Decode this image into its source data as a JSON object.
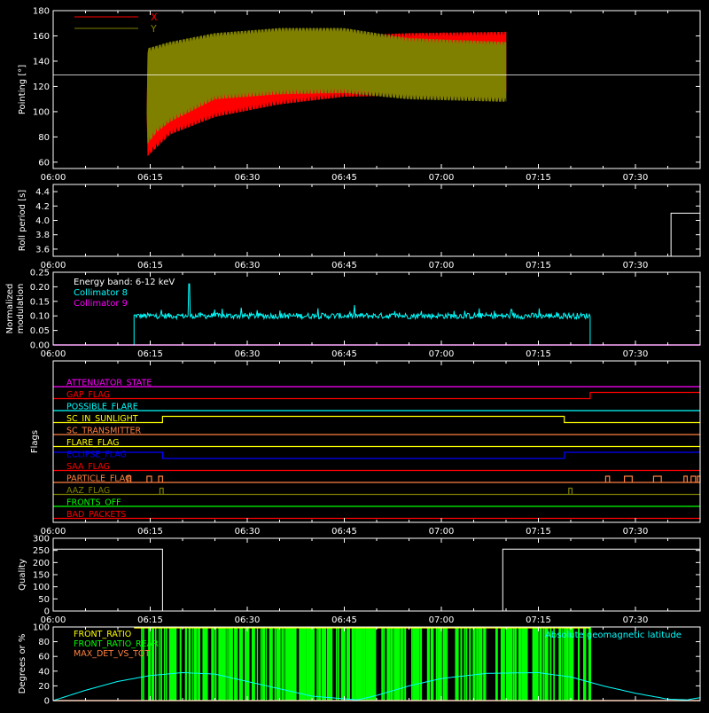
{
  "x_axis": {
    "ticks": [
      "06:00",
      "06:15",
      "06:30",
      "06:45",
      "07:00",
      "07:15",
      "07:30"
    ],
    "range_minutes": [
      0,
      100
    ]
  },
  "chart_data": [
    {
      "type": "area",
      "ylabel": "Pointing [°]",
      "ylim": [
        55,
        180
      ],
      "yticks": [
        "60",
        "80",
        "100",
        "120",
        "140",
        "160",
        "180"
      ],
      "reference_line_y": 129,
      "legend": [
        {
          "label": "X",
          "color": "#ff0000"
        },
        {
          "label": "Y",
          "color": "#808000"
        }
      ],
      "series": [
        {
          "name": "X",
          "color": "#ff0000",
          "x_minutes": [
            14.5,
            14.6,
            16,
            18,
            25,
            35,
            45,
            55,
            70
          ],
          "upper": [
            100,
            150,
            145,
            147,
            152,
            155,
            160,
            162,
            163
          ],
          "lower": [
            100,
            65,
            72,
            82,
            96,
            106,
            112,
            113,
            115
          ]
        },
        {
          "name": "Y",
          "color": "#808000",
          "x_minutes": [
            14.5,
            14.6,
            16,
            18,
            25,
            35,
            45,
            55,
            70
          ],
          "upper": [
            100,
            150,
            152,
            155,
            162,
            166,
            166,
            158,
            155
          ],
          "lower": [
            100,
            75,
            84,
            92,
            110,
            114,
            115,
            110,
            108
          ]
        }
      ]
    },
    {
      "type": "line",
      "ylabel": "Roll period [s]",
      "ylim": [
        3.5,
        4.5
      ],
      "yticks": [
        "3.6",
        "3.8",
        "4.0",
        "4.2",
        "4.4"
      ],
      "series": [
        {
          "name": "",
          "color": "#ffffff",
          "x_minutes": [
            95.5,
            95.5,
            100
          ],
          "values": [
            3.5,
            4.1,
            4.1
          ]
        }
      ]
    },
    {
      "type": "line",
      "ylabel": "Normalized modulation",
      "ylim": [
        0,
        0.25
      ],
      "yticks": [
        "0.00",
        "0.05",
        "0.10",
        "0.15",
        "0.20",
        "0.25"
      ],
      "legend_title": "Energy band: 6-12 keV",
      "legend": [
        {
          "label": "Collimator 8",
          "color": "#00ffff"
        },
        {
          "label": "Collimator 9",
          "color": "#ff00ff"
        }
      ],
      "series": [
        {
          "name": "Collimator 8",
          "color": "#00ffff",
          "x_range": [
            12.5,
            83
          ],
          "typical": 0.1,
          "spread": 0.01,
          "spike": [
            21,
            0.21
          ]
        },
        {
          "name": "Collimator 9",
          "color": "#ff00ff",
          "x_range": [
            0,
            100
          ],
          "typical": 0,
          "spread": 0
        }
      ]
    },
    {
      "type": "line",
      "ylabel": "Flags",
      "flags": [
        {
          "label": "ATTENUATOR_STATE",
          "color": "#ff00ff",
          "segments": [
            [
              0,
              100,
              0
            ]
          ]
        },
        {
          "label": "GAP_FLAG",
          "color": "#ff0000",
          "segments": [
            [
              0,
              83,
              0
            ],
            [
              83,
              100,
              1
            ]
          ]
        },
        {
          "label": "POSSIBLE_FLARE",
          "color": "#00ffff",
          "segments": [
            [
              0,
              100,
              0
            ]
          ]
        },
        {
          "label": "SC_IN_SUNLIGHT",
          "color": "#ffff00",
          "segments": [
            [
              0,
              16.9,
              0
            ],
            [
              16.9,
              79,
              1
            ],
            [
              79,
              100,
              0
            ]
          ]
        },
        {
          "label": "SC_TRANSMITTER",
          "color": "#ff8040",
          "segments": [
            [
              0,
              100,
              0
            ]
          ]
        },
        {
          "label": "FLARE_FLAG",
          "color": "#ffff00",
          "segments": [
            [
              0,
              100,
              0
            ]
          ]
        },
        {
          "label": "ECLIPSE_FLAG",
          "color": "#0000ff",
          "segments": [
            [
              0,
              16.9,
              1
            ],
            [
              16.9,
              79,
              0
            ],
            [
              79,
              100,
              1
            ]
          ]
        },
        {
          "label": "SAA_FLAG",
          "color": "#ff0000",
          "segments": [
            [
              0,
              100,
              0
            ]
          ]
        },
        {
          "label": "PARTICLE_FLAG",
          "color": "#ff8040",
          "segments": [
            [
              0,
              100,
              0
            ]
          ],
          "pulses": [
            [
              11.5,
              12.0
            ],
            [
              14.5,
              15.2
            ],
            [
              16.3,
              16.9
            ],
            [
              85.4,
              86.0
            ],
            [
              88.3,
              89.5
            ],
            [
              92.8,
              94.0
            ],
            [
              97.5,
              98.0
            ],
            [
              98.6,
              99.3
            ],
            [
              99.6,
              100
            ]
          ]
        },
        {
          "label": "AAZ_FLAG",
          "color": "#808000",
          "segments": [
            [
              0,
              100,
              0
            ]
          ],
          "pulses": [
            [
              16.5,
              17.0
            ],
            [
              79.7,
              80.2
            ]
          ]
        },
        {
          "label": "FRONTS_OFF",
          "color": "#00ff00",
          "segments": [
            [
              0,
              100,
              0
            ]
          ]
        },
        {
          "label": "BAD_PACKETS",
          "color": "#ff0000",
          "segments": [
            [
              0,
              100,
              0
            ]
          ]
        }
      ]
    },
    {
      "type": "line",
      "ylabel": "Quality",
      "ylim": [
        0,
        300
      ],
      "yticks": [
        "0",
        "50",
        "100",
        "150",
        "200",
        "250",
        "300"
      ],
      "series": [
        {
          "name": "",
          "color": "#ffffff",
          "x_minutes": [
            0,
            16.9,
            16.9,
            69.5,
            69.5,
            100
          ],
          "values": [
            255,
            255,
            0,
            0,
            255,
            255
          ]
        }
      ]
    },
    {
      "type": "bar",
      "ylabel": "Degrees or %",
      "ylim": [
        0,
        100
      ],
      "yticks": [
        "0",
        "20",
        "40",
        "60",
        "80",
        "100"
      ],
      "legend": [
        {
          "label": "FRONT_RATIO",
          "color": "#ffff00"
        },
        {
          "label": "FRONT_RATIO_REAR",
          "color": "#00ff00"
        },
        {
          "label": "MAX_DET_VS_TOT",
          "color": "#ff8040"
        }
      ],
      "legend_right": {
        "label": "Absolute geomagnetic latitude",
        "color": "#00ffff"
      },
      "series": [
        {
          "name": "FRONT_RATIO_REAR",
          "color": "#00ff00",
          "x_range": [
            12.5,
            83
          ],
          "values": [
            0,
            100
          ]
        },
        {
          "name": "Absolute geomagnetic latitude",
          "color": "#00ffff",
          "x_minutes": [
            0,
            5,
            10,
            15,
            20,
            25,
            32,
            40,
            47,
            50,
            55,
            60,
            67,
            75,
            80,
            85,
            90,
            95,
            98,
            100
          ],
          "values": [
            0,
            14,
            26,
            34,
            38,
            36,
            22,
            6,
            1,
            7,
            20,
            30,
            37,
            38,
            32,
            20,
            10,
            2,
            1,
            4
          ]
        }
      ]
    }
  ]
}
